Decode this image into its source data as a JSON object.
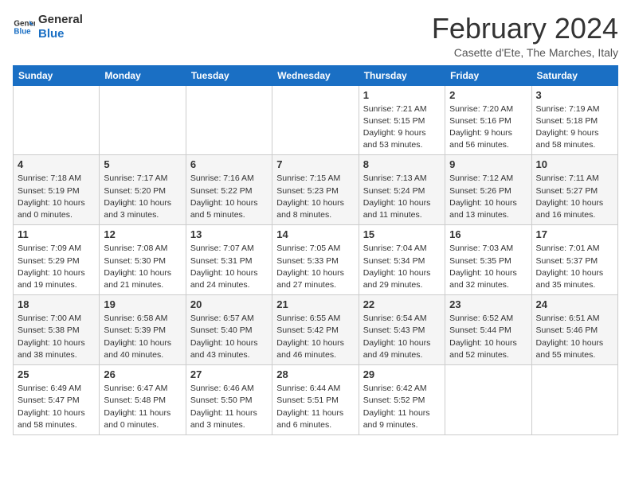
{
  "logo": {
    "line1": "General",
    "line2": "Blue"
  },
  "title": "February 2024",
  "location": "Casette d'Ete, The Marches, Italy",
  "days_header": [
    "Sunday",
    "Monday",
    "Tuesday",
    "Wednesday",
    "Thursday",
    "Friday",
    "Saturday"
  ],
  "weeks": [
    [
      {
        "num": "",
        "info": ""
      },
      {
        "num": "",
        "info": ""
      },
      {
        "num": "",
        "info": ""
      },
      {
        "num": "",
        "info": ""
      },
      {
        "num": "1",
        "info": "Sunrise: 7:21 AM\nSunset: 5:15 PM\nDaylight: 9 hours\nand 53 minutes."
      },
      {
        "num": "2",
        "info": "Sunrise: 7:20 AM\nSunset: 5:16 PM\nDaylight: 9 hours\nand 56 minutes."
      },
      {
        "num": "3",
        "info": "Sunrise: 7:19 AM\nSunset: 5:18 PM\nDaylight: 9 hours\nand 58 minutes."
      }
    ],
    [
      {
        "num": "4",
        "info": "Sunrise: 7:18 AM\nSunset: 5:19 PM\nDaylight: 10 hours\nand 0 minutes."
      },
      {
        "num": "5",
        "info": "Sunrise: 7:17 AM\nSunset: 5:20 PM\nDaylight: 10 hours\nand 3 minutes."
      },
      {
        "num": "6",
        "info": "Sunrise: 7:16 AM\nSunset: 5:22 PM\nDaylight: 10 hours\nand 5 minutes."
      },
      {
        "num": "7",
        "info": "Sunrise: 7:15 AM\nSunset: 5:23 PM\nDaylight: 10 hours\nand 8 minutes."
      },
      {
        "num": "8",
        "info": "Sunrise: 7:13 AM\nSunset: 5:24 PM\nDaylight: 10 hours\nand 11 minutes."
      },
      {
        "num": "9",
        "info": "Sunrise: 7:12 AM\nSunset: 5:26 PM\nDaylight: 10 hours\nand 13 minutes."
      },
      {
        "num": "10",
        "info": "Sunrise: 7:11 AM\nSunset: 5:27 PM\nDaylight: 10 hours\nand 16 minutes."
      }
    ],
    [
      {
        "num": "11",
        "info": "Sunrise: 7:09 AM\nSunset: 5:29 PM\nDaylight: 10 hours\nand 19 minutes."
      },
      {
        "num": "12",
        "info": "Sunrise: 7:08 AM\nSunset: 5:30 PM\nDaylight: 10 hours\nand 21 minutes."
      },
      {
        "num": "13",
        "info": "Sunrise: 7:07 AM\nSunset: 5:31 PM\nDaylight: 10 hours\nand 24 minutes."
      },
      {
        "num": "14",
        "info": "Sunrise: 7:05 AM\nSunset: 5:33 PM\nDaylight: 10 hours\nand 27 minutes."
      },
      {
        "num": "15",
        "info": "Sunrise: 7:04 AM\nSunset: 5:34 PM\nDaylight: 10 hours\nand 29 minutes."
      },
      {
        "num": "16",
        "info": "Sunrise: 7:03 AM\nSunset: 5:35 PM\nDaylight: 10 hours\nand 32 minutes."
      },
      {
        "num": "17",
        "info": "Sunrise: 7:01 AM\nSunset: 5:37 PM\nDaylight: 10 hours\nand 35 minutes."
      }
    ],
    [
      {
        "num": "18",
        "info": "Sunrise: 7:00 AM\nSunset: 5:38 PM\nDaylight: 10 hours\nand 38 minutes."
      },
      {
        "num": "19",
        "info": "Sunrise: 6:58 AM\nSunset: 5:39 PM\nDaylight: 10 hours\nand 40 minutes."
      },
      {
        "num": "20",
        "info": "Sunrise: 6:57 AM\nSunset: 5:40 PM\nDaylight: 10 hours\nand 43 minutes."
      },
      {
        "num": "21",
        "info": "Sunrise: 6:55 AM\nSunset: 5:42 PM\nDaylight: 10 hours\nand 46 minutes."
      },
      {
        "num": "22",
        "info": "Sunrise: 6:54 AM\nSunset: 5:43 PM\nDaylight: 10 hours\nand 49 minutes."
      },
      {
        "num": "23",
        "info": "Sunrise: 6:52 AM\nSunset: 5:44 PM\nDaylight: 10 hours\nand 52 minutes."
      },
      {
        "num": "24",
        "info": "Sunrise: 6:51 AM\nSunset: 5:46 PM\nDaylight: 10 hours\nand 55 minutes."
      }
    ],
    [
      {
        "num": "25",
        "info": "Sunrise: 6:49 AM\nSunset: 5:47 PM\nDaylight: 10 hours\nand 58 minutes."
      },
      {
        "num": "26",
        "info": "Sunrise: 6:47 AM\nSunset: 5:48 PM\nDaylight: 11 hours\nand 0 minutes."
      },
      {
        "num": "27",
        "info": "Sunrise: 6:46 AM\nSunset: 5:50 PM\nDaylight: 11 hours\nand 3 minutes."
      },
      {
        "num": "28",
        "info": "Sunrise: 6:44 AM\nSunset: 5:51 PM\nDaylight: 11 hours\nand 6 minutes."
      },
      {
        "num": "29",
        "info": "Sunrise: 6:42 AM\nSunset: 5:52 PM\nDaylight: 11 hours\nand 9 minutes."
      },
      {
        "num": "",
        "info": ""
      },
      {
        "num": "",
        "info": ""
      }
    ]
  ]
}
